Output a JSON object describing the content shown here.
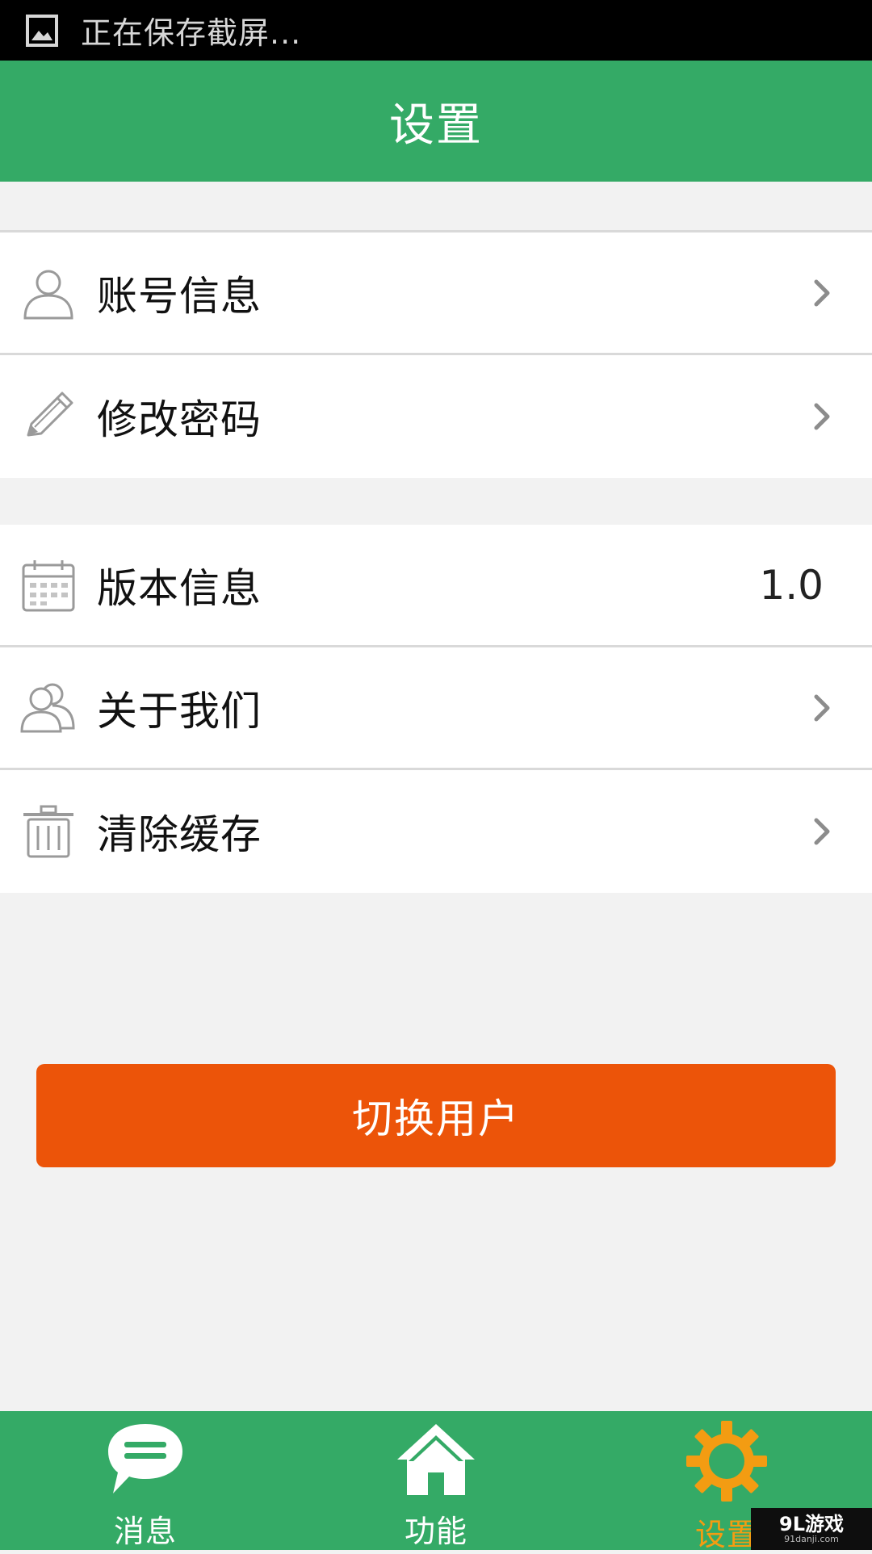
{
  "status_bar": {
    "text": "正在保存截屏...",
    "icon": "image-icon"
  },
  "header": {
    "title": "设置"
  },
  "group1": {
    "items": [
      {
        "label": "账号信息",
        "icon": "user-icon"
      },
      {
        "label": "修改密码",
        "icon": "pencil-icon"
      }
    ]
  },
  "group2": {
    "items": [
      {
        "label": "版本信息",
        "icon": "calendar-icon",
        "value": "1.0"
      },
      {
        "label": "关于我们",
        "icon": "users-icon"
      },
      {
        "label": "清除缓存",
        "icon": "trash-icon"
      }
    ]
  },
  "switch_user": {
    "label": "切换用户"
  },
  "bottom_nav": {
    "items": [
      {
        "label": "消息",
        "icon": "chat-bubble-icon",
        "active": false
      },
      {
        "label": "功能",
        "icon": "home-icon",
        "active": false
      },
      {
        "label": "设置",
        "icon": "gear-icon",
        "active": true
      }
    ]
  },
  "watermark": {
    "main": "9L游戏",
    "sub": "91danji.com"
  },
  "colors": {
    "brand_green": "#34aa66",
    "button_orange": "#ec5409",
    "active_orange": "#f39c12"
  }
}
